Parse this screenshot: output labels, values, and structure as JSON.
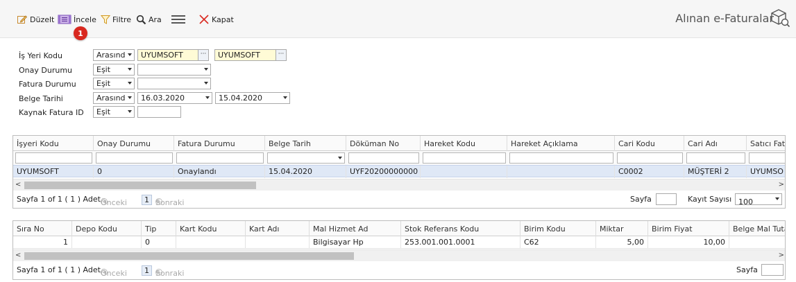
{
  "toolbar": {
    "edit_label": "Düzelt",
    "inspect_label": "İncele",
    "filter_label": "Filtre",
    "search_label": "Ara",
    "close_label": "Kapat",
    "badge": "1",
    "title": "Alınan e-Faturalar"
  },
  "filters": [
    {
      "label": "İş Yeri Kodu",
      "operator": "Arasınd",
      "value1": "UYUMSOFT",
      "value2": "UYUMSOFT"
    },
    {
      "label": "Onay Durumu",
      "operator": "Eşit",
      "value1": ""
    },
    {
      "label": "Fatura Durumu",
      "operator": "Eşit",
      "value1": ""
    },
    {
      "label": "Belge Tarihi",
      "operator": "Arasınd",
      "value1": "16.03.2020",
      "value2": "15.04.2020"
    },
    {
      "label": "Kaynak Fatura ID",
      "operator": "Eşit",
      "value1": ""
    }
  ],
  "grid1": {
    "columns": [
      "İşyeri Kodu",
      "Onay Durumu",
      "Fatura Durumu",
      "Belge Tarih",
      "Döküman No",
      "Hareket Kodu",
      "Hareket Açıklama",
      "Cari Kodu",
      "Cari Adı",
      "Satıcı Fat"
    ],
    "rows": [
      [
        "UYUMSOFT",
        "0",
        "Onaylandı",
        "15.04.2020",
        "UYF20200000000",
        "",
        "",
        "C0002",
        "MÜŞTERİ 2",
        "UYUMSO"
      ]
    ],
    "pager": {
      "info": "Sayfa 1 of 1 ( 1 ) Adet",
      "prev": "Önceki",
      "page": "1",
      "next": "Sonraki",
      "page_label": "Sayfa",
      "count_label": "Kayıt Sayısı",
      "count_value": "100"
    }
  },
  "grid2": {
    "columns": [
      "Sıra No",
      "Depo Kodu",
      "Tip",
      "Kart Kodu",
      "Kart Adı",
      "Mal Hizmet Ad",
      "Stok Referans Kodu",
      "Birim Kodu",
      "Miktar",
      "Birim Fiyat",
      "Belge Mal Tutar"
    ],
    "rows": [
      [
        "1",
        "",
        "0",
        "",
        "",
        "Bilgisayar Hp",
        "253.001.001.0001",
        "C62",
        "5,00",
        "10,00",
        ""
      ]
    ],
    "pager": {
      "info": "Sayfa 1 of 1 ( 1 ) Adet",
      "prev": "Önceki",
      "page": "1",
      "next": "Sonraki",
      "page_label": "Sayfa"
    }
  }
}
